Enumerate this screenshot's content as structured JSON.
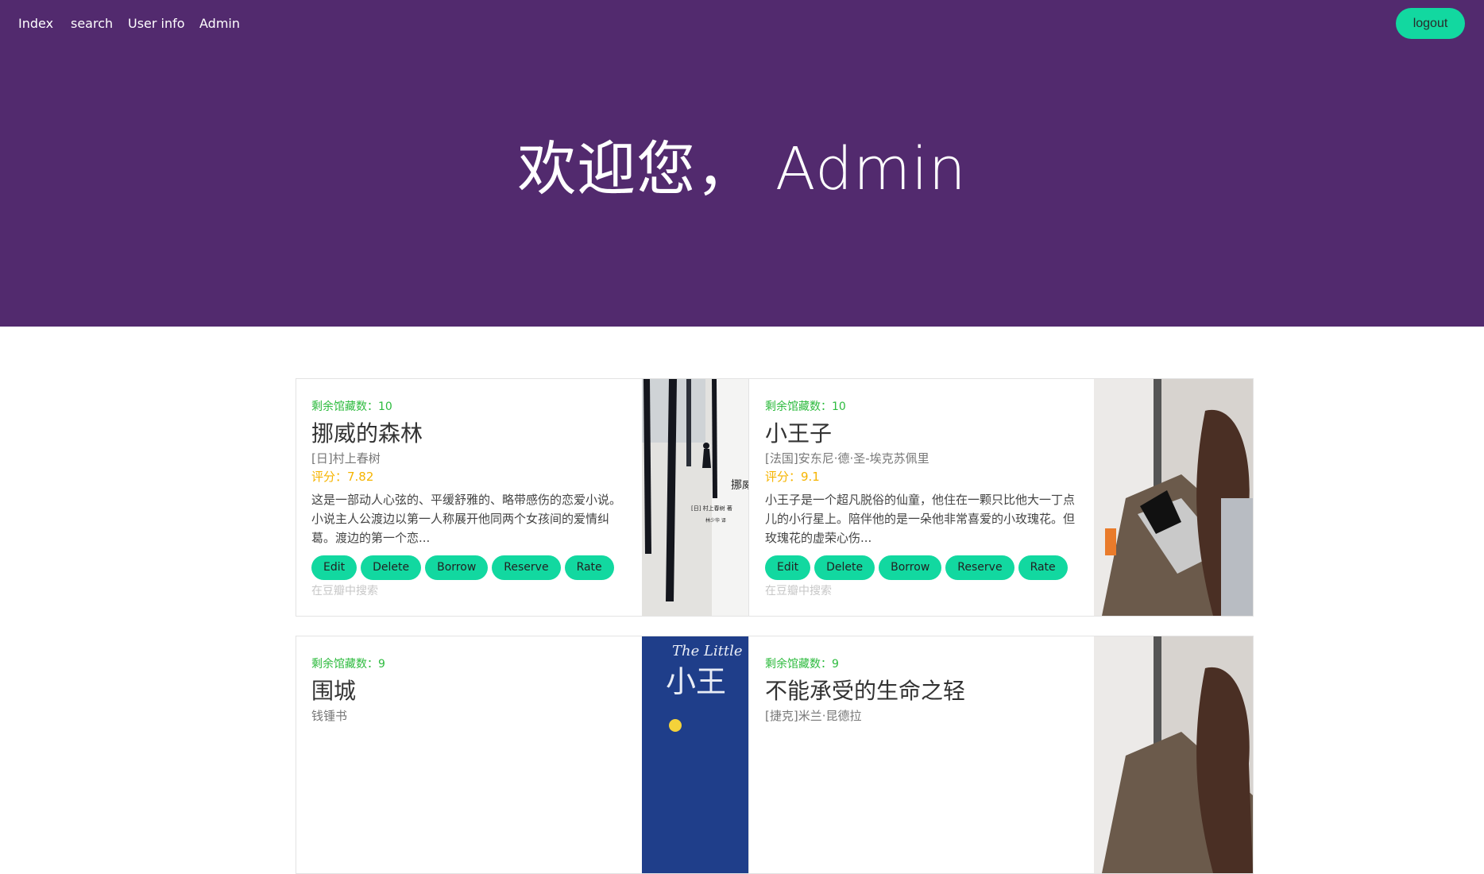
{
  "nav": {
    "index": "Index",
    "search": "search",
    "user_info": "User info",
    "admin": "Admin",
    "logout": "logout"
  },
  "hero": {
    "welcome": "欢迎您， Admin"
  },
  "colors": {
    "hero_bg": "#522a6e",
    "accent": "#12d8a0",
    "stock": "#2dbb3e",
    "rating": "#f6b400"
  },
  "books": [
    {
      "stock_label": "剩余馆藏数：10",
      "title": "挪威的森林",
      "author": "[日]村上春树",
      "rating": "评分：7.82",
      "desc": "这是一部动人心弦的、平缓舒雅的、略带感伤的恋爱小说。小说主人公渡边以第一人称展开他同两个女孩间的爱情纠葛。渡边的第一个恋...",
      "search_link": "在豆瓣中搜索",
      "cover_icon": "book-cover-image"
    },
    {
      "stock_label": "剩余馆藏数：10",
      "title": "小王子",
      "author": "[法国]安东尼·德·圣-埃克苏佩里",
      "rating": "评分：9.1",
      "desc": "小王子是一个超凡脱俗的仙童，他住在一颗只比他大一丁点儿的小行星上。陪伴他的是一朵他非常喜爱的小玫瑰花。但玫瑰花的虚荣心伤...",
      "search_link": "在豆瓣中搜索",
      "cover_icon": "book-cover-image"
    },
    {
      "stock_label": "剩余馆藏数：9",
      "title": "围城",
      "author": "钱锺书",
      "rating": "",
      "desc": "",
      "search_link": "",
      "cover_icon": "book-cover-image"
    },
    {
      "stock_label": "剩余馆藏数：9",
      "title": "不能承受的生命之轻",
      "author": "[捷克]米兰·昆德拉",
      "rating": "",
      "desc": "",
      "search_link": "",
      "cover_icon": "book-cover-image"
    }
  ],
  "actions": {
    "edit": "Edit",
    "delete": "Delete",
    "borrow": "Borrow",
    "reserve": "Reserve",
    "rate": "Rate"
  },
  "cover_texts": {
    "forest_title": "挪威",
    "forest_author": "[日] 村上春树 著",
    "forest_translator": "林少华 译",
    "little_prince_script": "The Little",
    "little_prince_cn": "小王"
  }
}
